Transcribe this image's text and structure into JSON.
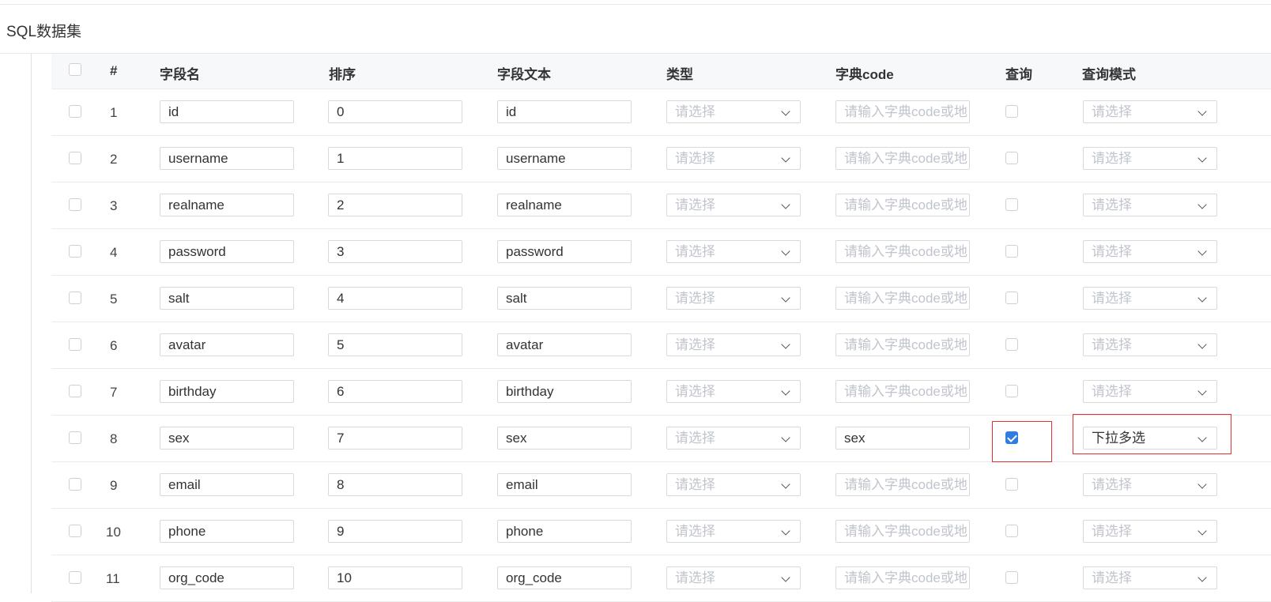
{
  "page": {
    "title": "SQL数据集"
  },
  "table": {
    "headers": {
      "index": "#",
      "field_name": "字段名",
      "order": "排序",
      "field_text": "字段文本",
      "type": "类型",
      "dict_code": "字典code",
      "query": "查询",
      "query_mode": "查询模式"
    },
    "placeholders": {
      "type": "请选择",
      "dict_code": "请输入字典code或地",
      "query_mode": "请选择"
    },
    "rows": [
      {
        "index": "1",
        "field_name": "id",
        "order": "0",
        "field_text": "id",
        "dict_code": "",
        "query": false,
        "query_mode": ""
      },
      {
        "index": "2",
        "field_name": "username",
        "order": "1",
        "field_text": "username",
        "dict_code": "",
        "query": false,
        "query_mode": ""
      },
      {
        "index": "3",
        "field_name": "realname",
        "order": "2",
        "field_text": "realname",
        "dict_code": "",
        "query": false,
        "query_mode": ""
      },
      {
        "index": "4",
        "field_name": "password",
        "order": "3",
        "field_text": "password",
        "dict_code": "",
        "query": false,
        "query_mode": ""
      },
      {
        "index": "5",
        "field_name": "salt",
        "order": "4",
        "field_text": "salt",
        "dict_code": "",
        "query": false,
        "query_mode": ""
      },
      {
        "index": "6",
        "field_name": "avatar",
        "order": "5",
        "field_text": "avatar",
        "dict_code": "",
        "query": false,
        "query_mode": ""
      },
      {
        "index": "7",
        "field_name": "birthday",
        "order": "6",
        "field_text": "birthday",
        "dict_code": "",
        "query": false,
        "query_mode": ""
      },
      {
        "index": "8",
        "field_name": "sex",
        "order": "7",
        "field_text": "sex",
        "dict_code": "sex",
        "query": true,
        "query_mode": "下拉多选"
      },
      {
        "index": "9",
        "field_name": "email",
        "order": "8",
        "field_text": "email",
        "dict_code": "",
        "query": false,
        "query_mode": ""
      },
      {
        "index": "10",
        "field_name": "phone",
        "order": "9",
        "field_text": "phone",
        "dict_code": "",
        "query": false,
        "query_mode": ""
      },
      {
        "index": "11",
        "field_name": "org_code",
        "order": "10",
        "field_text": "org_code",
        "dict_code": "",
        "query": false,
        "query_mode": ""
      }
    ]
  },
  "colors": {
    "accent": "#2f7de1",
    "highlight": "#e5322d"
  }
}
